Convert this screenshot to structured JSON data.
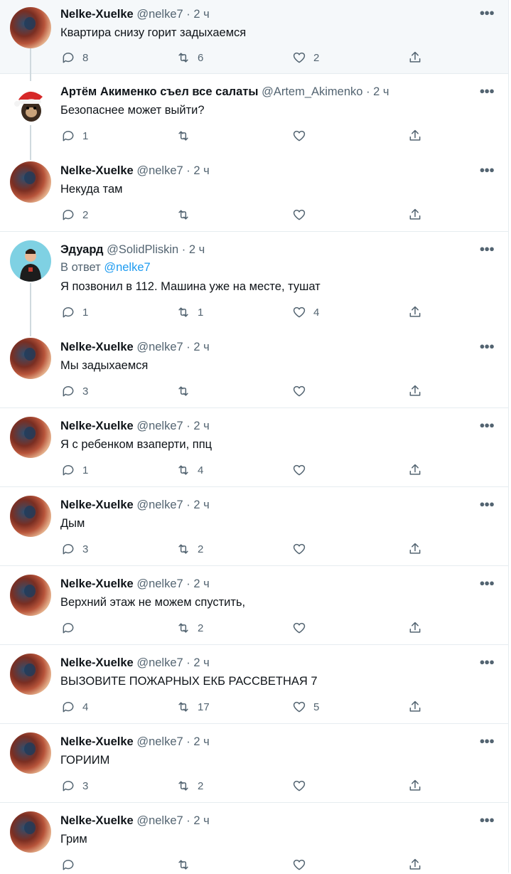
{
  "tweets": [
    {
      "author": "nelke",
      "name": "Nelke-Xuelke",
      "handle": "@nelke7",
      "time": "2 ч",
      "text": "Квартира снизу горит задыхаемся",
      "replies": "8",
      "retweets": "6",
      "likes": "2",
      "highlighted": true
    },
    {
      "author": "artem",
      "name": "Артём Акименко съел все салаты",
      "handle": "@Artem_Akimenko",
      "time": "2 ч",
      "text": "Безопаснее может выйти?",
      "replies": "1",
      "retweets": "",
      "likes": ""
    },
    {
      "author": "nelke",
      "name": "Nelke-Xuelke",
      "handle": "@nelke7",
      "time": "2 ч",
      "text": "Некуда там",
      "replies": "2",
      "retweets": "",
      "likes": ""
    },
    {
      "author": "eduard",
      "name": "Эдуард",
      "handle": "@SolidPliskin",
      "time": "2 ч",
      "reply_prefix": "В ответ",
      "reply_target": "@nelke7",
      "text": "Я позвонил в 112. Машина уже на месте, тушат",
      "replies": "1",
      "retweets": "1",
      "likes": "4"
    },
    {
      "author": "nelke",
      "name": "Nelke-Xuelke",
      "handle": "@nelke7",
      "time": "2 ч",
      "text": "Мы задыхаемся",
      "replies": "3",
      "retweets": "",
      "likes": ""
    },
    {
      "author": "nelke",
      "name": "Nelke-Xuelke",
      "handle": "@nelke7",
      "time": "2 ч",
      "text": "Я с ребенком взаперти, ппц",
      "replies": "1",
      "retweets": "4",
      "likes": ""
    },
    {
      "author": "nelke",
      "name": "Nelke-Xuelke",
      "handle": "@nelke7",
      "time": "2 ч",
      "text": "Дым",
      "replies": "3",
      "retweets": "2",
      "likes": ""
    },
    {
      "author": "nelke",
      "name": "Nelke-Xuelke",
      "handle": "@nelke7",
      "time": "2 ч",
      "text": "Верхний этаж не можем спустить,",
      "replies": "",
      "retweets": "2",
      "likes": ""
    },
    {
      "author": "nelke",
      "name": "Nelke-Xuelke",
      "handle": "@nelke7",
      "time": "2 ч",
      "text": "ВЫЗОВИТЕ ПОЖАРНЫХ ЕКБ РАССВЕТНАЯ 7",
      "replies": "4",
      "retweets": "17",
      "likes": "5"
    },
    {
      "author": "nelke",
      "name": "Nelke-Xuelke",
      "handle": "@nelke7",
      "time": "2 ч",
      "text": "ГОРИИМ",
      "replies": "3",
      "retweets": "2",
      "likes": ""
    },
    {
      "author": "nelke",
      "name": "Nelke-Xuelke",
      "handle": "@nelke7",
      "time": "2 ч",
      "text": "Грим",
      "replies": "",
      "retweets": "",
      "likes": ""
    }
  ],
  "icons": {
    "reply": "reply-icon",
    "retweet": "retweet-icon",
    "like": "heart-icon",
    "share": "share-icon",
    "more": "more-icon"
  },
  "colors": {
    "link": "#1d9bf0",
    "secondary": "#536471",
    "highlight_bg": "#f5f8fa"
  }
}
